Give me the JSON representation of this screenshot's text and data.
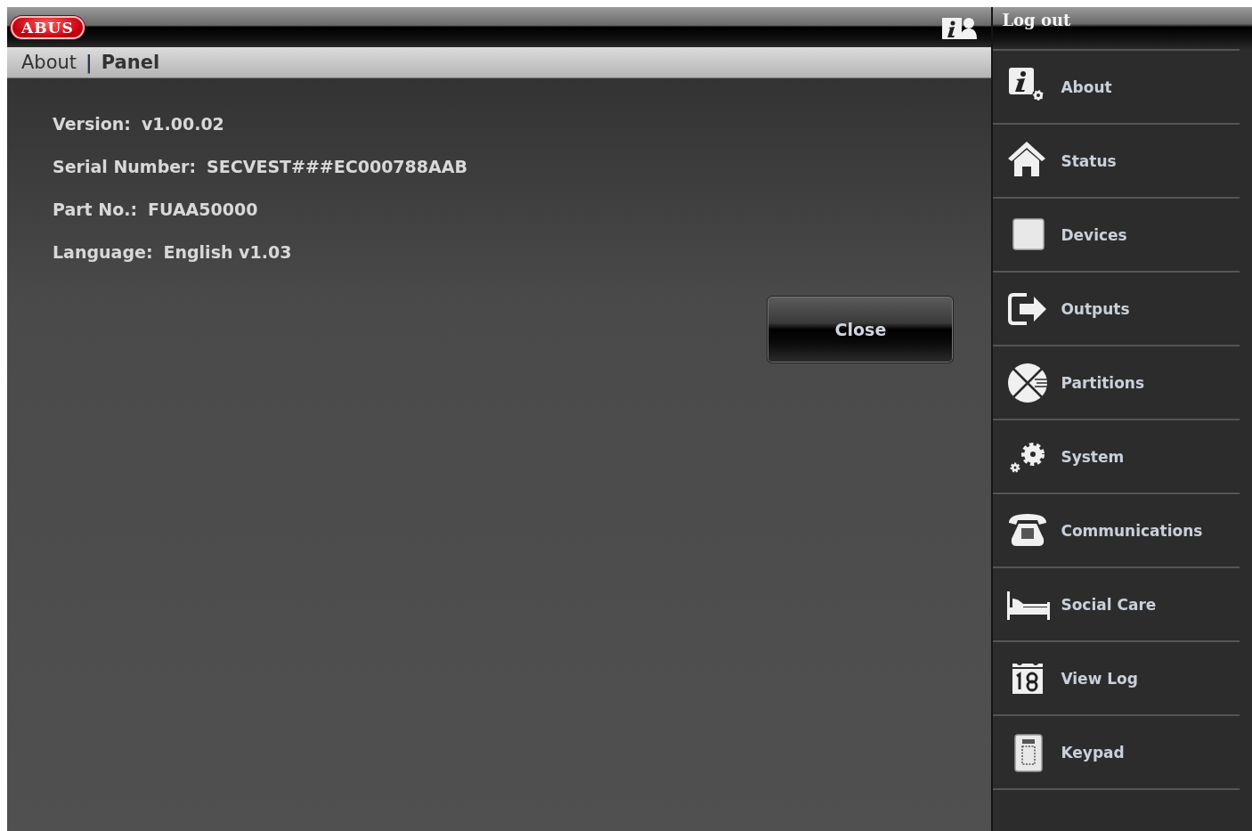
{
  "logo": {
    "text": "ABUS"
  },
  "breadcrumb": {
    "section": "About",
    "separator": "|",
    "page": "Panel"
  },
  "info": [
    {
      "label": "Version:",
      "value": "v1.00.02"
    },
    {
      "label": "Serial Number:",
      "value": "SECVEST###EC000788AAB"
    },
    {
      "label": "Part No.:",
      "value": "FUAA50000"
    },
    {
      "label": "Language:",
      "value": "English v1.03"
    }
  ],
  "close_button": "Close",
  "logout": "Log out",
  "sidebar": {
    "items": [
      {
        "label": "About"
      },
      {
        "label": "Status"
      },
      {
        "label": "Devices"
      },
      {
        "label": "Outputs"
      },
      {
        "label": "Partitions"
      },
      {
        "label": "System"
      },
      {
        "label": "Communications"
      },
      {
        "label": "Social Care"
      },
      {
        "label": "View Log"
      },
      {
        "label": "Keypad"
      }
    ]
  }
}
